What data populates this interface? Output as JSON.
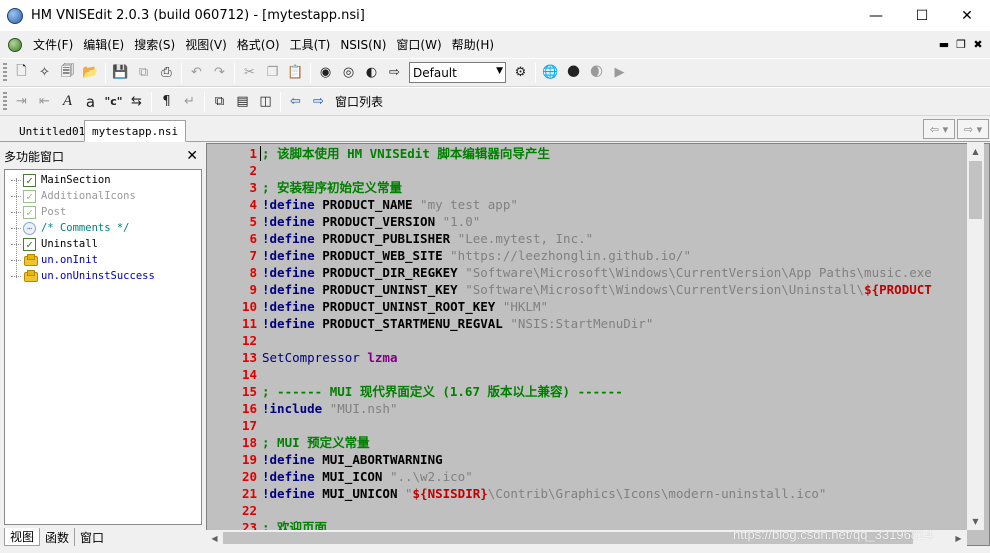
{
  "window": {
    "title": "HM VNISEdit 2.0.3 (build 060712) - [mytestapp.nsi]"
  },
  "menu": [
    "文件(F)",
    "编辑(E)",
    "搜索(S)",
    "视图(V)",
    "格式(O)",
    "工具(T)",
    "NSIS(N)",
    "窗口(W)",
    "帮助(H)"
  ],
  "toolbar": {
    "font_combo_value": "Default",
    "window_list_label": "窗口列表",
    "quote_button": "\"c\""
  },
  "tabs": [
    "Untitled01",
    "mytestapp.nsi"
  ],
  "panel": {
    "title": "多功能窗口",
    "tree": [
      {
        "label": "MainSection",
        "type": "section"
      },
      {
        "label": "AdditionalIcons",
        "type": "section-dim"
      },
      {
        "label": "Post",
        "type": "section-dim"
      },
      {
        "label": "/* Comments */",
        "type": "comment"
      },
      {
        "label": "Uninstall",
        "type": "section"
      },
      {
        "label": "un.onInit",
        "type": "function"
      },
      {
        "label": "un.onUninstSuccess",
        "type": "function"
      }
    ],
    "bottom_tabs": [
      "视图",
      "函数",
      "窗口"
    ]
  },
  "editor": {
    "lines": [
      {
        "n": "1",
        "parts": [
          {
            "t": "; 该脚本使用 HM VNISEdit 脚本编辑器向导产生",
            "c": "c-cmt"
          }
        ]
      },
      {
        "n": "2",
        "parts": []
      },
      {
        "n": "3",
        "parts": [
          {
            "t": "; 安装程序初始定义常量",
            "c": "c-cmt"
          }
        ]
      },
      {
        "n": "4",
        "parts": [
          {
            "t": "!define",
            "c": "c-dir"
          },
          {
            "t": " PRODUCT_NAME ",
            "c": "c-name"
          },
          {
            "t": "\"my test app\"",
            "c": "c-str"
          }
        ]
      },
      {
        "n": "5",
        "parts": [
          {
            "t": "!define",
            "c": "c-dir"
          },
          {
            "t": " PRODUCT_VERSION ",
            "c": "c-name"
          },
          {
            "t": "\"1.0\"",
            "c": "c-str"
          }
        ]
      },
      {
        "n": "6",
        "parts": [
          {
            "t": "!define",
            "c": "c-dir"
          },
          {
            "t": " PRODUCT_PUBLISHER ",
            "c": "c-name"
          },
          {
            "t": "\"Lee.mytest, Inc.\"",
            "c": "c-str"
          }
        ]
      },
      {
        "n": "7",
        "parts": [
          {
            "t": "!define",
            "c": "c-dir"
          },
          {
            "t": " PRODUCT_WEB_SITE ",
            "c": "c-name"
          },
          {
            "t": "\"https://leezhonglin.github.io/\"",
            "c": "c-str"
          }
        ]
      },
      {
        "n": "8",
        "parts": [
          {
            "t": "!define",
            "c": "c-dir"
          },
          {
            "t": " PRODUCT_DIR_REGKEY ",
            "c": "c-name"
          },
          {
            "t": "\"Software\\Microsoft\\Windows\\CurrentVersion\\App Paths\\music.exe",
            "c": "c-str"
          }
        ]
      },
      {
        "n": "9",
        "parts": [
          {
            "t": "!define",
            "c": "c-dir"
          },
          {
            "t": " PRODUCT_UNINST_KEY ",
            "c": "c-name"
          },
          {
            "t": "\"Software\\Microsoft\\Windows\\CurrentVersion\\Uninstall\\",
            "c": "c-str"
          },
          {
            "t": "${PRODUCT",
            "c": "c-var"
          }
        ]
      },
      {
        "n": "10",
        "parts": [
          {
            "t": "!define",
            "c": "c-dir"
          },
          {
            "t": " PRODUCT_UNINST_ROOT_KEY ",
            "c": "c-name"
          },
          {
            "t": "\"HKLM\"",
            "c": "c-str"
          }
        ]
      },
      {
        "n": "11",
        "parts": [
          {
            "t": "!define",
            "c": "c-dir"
          },
          {
            "t": " PRODUCT_STARTMENU_REGVAL ",
            "c": "c-name"
          },
          {
            "t": "\"NSIS:StartMenuDir\"",
            "c": "c-str"
          }
        ]
      },
      {
        "n": "12",
        "parts": []
      },
      {
        "n": "13",
        "parts": [
          {
            "t": "SetCompressor",
            "c": "c-kw"
          },
          {
            "t": " lzma",
            "c": "c-kw2"
          }
        ]
      },
      {
        "n": "14",
        "parts": []
      },
      {
        "n": "15",
        "parts": [
          {
            "t": "; ------ MUI 现代界面定义 (1.67 版本以上兼容) ------",
            "c": "c-cmt"
          }
        ]
      },
      {
        "n": "16",
        "parts": [
          {
            "t": "!include",
            "c": "c-dir"
          },
          {
            "t": " \"MUI.nsh\"",
            "c": "c-str"
          }
        ]
      },
      {
        "n": "17",
        "parts": []
      },
      {
        "n": "18",
        "parts": [
          {
            "t": "; MUI 预定义常量",
            "c": "c-cmt"
          }
        ]
      },
      {
        "n": "19",
        "parts": [
          {
            "t": "!define",
            "c": "c-dir"
          },
          {
            "t": " MUI_ABORTWARNING",
            "c": "c-name"
          }
        ]
      },
      {
        "n": "20",
        "parts": [
          {
            "t": "!define",
            "c": "c-dir"
          },
          {
            "t": " MUI_ICON ",
            "c": "c-name"
          },
          {
            "t": "\"..\\w2.ico\"",
            "c": "c-str"
          }
        ]
      },
      {
        "n": "21",
        "parts": [
          {
            "t": "!define",
            "c": "c-dir"
          },
          {
            "t": " MUI_UNICON ",
            "c": "c-name"
          },
          {
            "t": "\"",
            "c": "c-str"
          },
          {
            "t": "${NSISDIR}",
            "c": "c-var"
          },
          {
            "t": "\\Contrib\\Graphics\\Icons\\modern-uninstall.ico\"",
            "c": "c-str"
          }
        ]
      },
      {
        "n": "22",
        "parts": []
      },
      {
        "n": "23",
        "parts": [
          {
            "t": "; 欢迎页面",
            "c": "c-cmt"
          }
        ]
      }
    ]
  },
  "watermark": "https://blog.csdn.net/qq_33196814",
  "colors": {
    "editor_bg": "#c0c0c0",
    "line_number": "#e00000",
    "comment": "#008000",
    "directive": "#000080"
  }
}
